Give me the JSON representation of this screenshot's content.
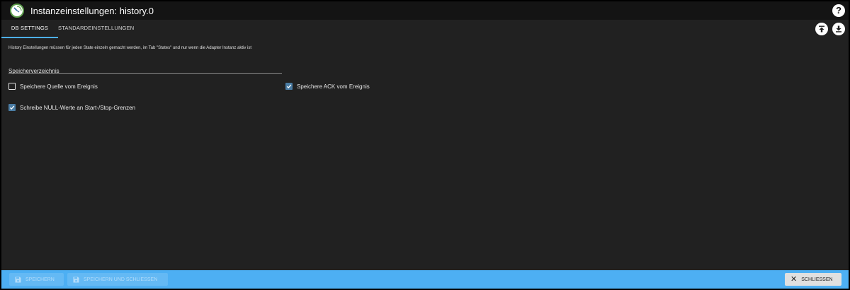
{
  "header": {
    "title": "Instanzeinstellungen: history.0",
    "help_icon": "help-circle-icon",
    "help_symbol": "?"
  },
  "tabs": [
    {
      "label": "DB SETTINGS",
      "active": true
    },
    {
      "label": "STANDARDEINSTELLUNGEN",
      "active": false
    }
  ],
  "toolbar": {
    "upload_icon": "upload-icon",
    "download_icon": "download-icon"
  },
  "main": {
    "info_text": "History Einstellungen müssen für jeden State einzeln gemacht werden, im Tab \"States\" und nur wenn die Adapter Instanz aktiv ist",
    "storage_dir_label": "Speicherverzeichnis",
    "checkboxes": [
      {
        "label": "Speichere Quelle vom Ereignis",
        "checked": false
      },
      {
        "label": "Speichere ACK vom Ereignis",
        "checked": true
      },
      {
        "label": "Schreibe NULL-Werte an Start-/Stop-Grenzen",
        "checked": true
      }
    ]
  },
  "footer": {
    "save_label": "SPEICHERN",
    "save_close_label": "SPEICHERN UND SCHLIESSEN",
    "close_label": "SCHLIESSEN",
    "close_symbol": "✕"
  },
  "colors": {
    "accent": "#4daff3",
    "checkbox_checked": "#4a7ca3",
    "background": "#212121",
    "topbar": "#141414"
  }
}
